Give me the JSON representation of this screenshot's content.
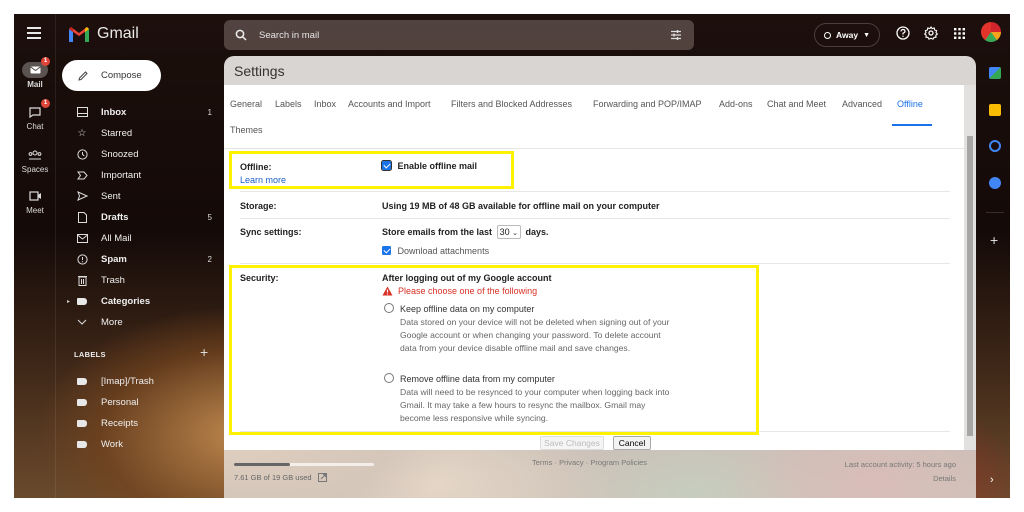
{
  "app": {
    "name": "Gmail"
  },
  "rail": {
    "items": [
      {
        "label": "Mail",
        "icon": "mail-icon",
        "badge": "1",
        "active": true
      },
      {
        "label": "Chat",
        "icon": "chat-icon",
        "badge": "1"
      },
      {
        "label": "Spaces",
        "icon": "spaces-icon"
      },
      {
        "label": "Meet",
        "icon": "meet-icon"
      }
    ]
  },
  "compose": {
    "label": "Compose"
  },
  "nav": {
    "items": [
      {
        "label": "Inbox",
        "count": "1",
        "bold": true,
        "icon": "inbox-icon"
      },
      {
        "label": "Starred",
        "icon": "star-icon"
      },
      {
        "label": "Snoozed",
        "icon": "clock-icon"
      },
      {
        "label": "Important",
        "icon": "important-icon"
      },
      {
        "label": "Sent",
        "icon": "send-icon"
      },
      {
        "label": "Drafts",
        "count": "5",
        "bold": true,
        "icon": "draft-icon"
      },
      {
        "label": "All Mail",
        "icon": "all-mail-icon"
      },
      {
        "label": "Spam",
        "count": "2",
        "bold": true,
        "icon": "spam-icon"
      },
      {
        "label": "Trash",
        "icon": "trash-icon"
      },
      {
        "label": "Categories",
        "bold": true,
        "icon": "label-icon"
      },
      {
        "label": "More",
        "icon": "chevron-down-icon"
      }
    ],
    "labels_header": "LABELS",
    "labels": [
      "[Imap]/Trash",
      "Personal",
      "Receipts",
      "Work"
    ]
  },
  "search": {
    "placeholder": "Search in mail"
  },
  "status": {
    "label": "Away"
  },
  "settings": {
    "title": "Settings",
    "tabs": [
      "General",
      "Labels",
      "Inbox",
      "Accounts and Import",
      "Filters and Blocked Addresses",
      "Forwarding and POP/IMAP",
      "Add-ons",
      "Chat and Meet",
      "Advanced",
      "Offline",
      "Themes"
    ],
    "active_tab": "Offline",
    "offline": {
      "label": "Offline:",
      "learn_more": "Learn more",
      "enable_label": "Enable offline mail",
      "enabled": true
    },
    "storage": {
      "label": "Storage:",
      "value": "Using 19 MB of 48 GB available for offline mail on your computer"
    },
    "sync": {
      "label": "Sync settings:",
      "prefix": "Store emails from the last",
      "days_value": "30",
      "suffix": "days.",
      "download_label": "Download attachments",
      "download_checked": true
    },
    "security": {
      "label": "Security:",
      "heading": "After logging out of my Google account",
      "warning": "Please choose one of the following",
      "options": [
        {
          "title": "Keep offline data on my computer",
          "desc": "Data stored on your device will not be deleted when signing out of your Google account or when changing your password. To delete account data from your device disable offline mail and save changes."
        },
        {
          "title": "Remove offline data from my computer",
          "desc": "Data will need to be resynced to your computer when logging back into Gmail. It may take a few hours to resync the mailbox. Gmail may become less responsive while syncing."
        }
      ]
    },
    "buttons": {
      "save": "Save Changes",
      "cancel": "Cancel"
    }
  },
  "footer": {
    "quota_text": "7.61 GB of 19 GB used",
    "quota_fraction": 0.4,
    "links": [
      "Terms",
      "Privacy",
      "Program Policies"
    ],
    "activity": "Last account activity: 5 hours ago",
    "details": "Details"
  },
  "colors": {
    "accent": "#1a73e8",
    "highlight": "#fff200",
    "warning": "#d93025"
  }
}
